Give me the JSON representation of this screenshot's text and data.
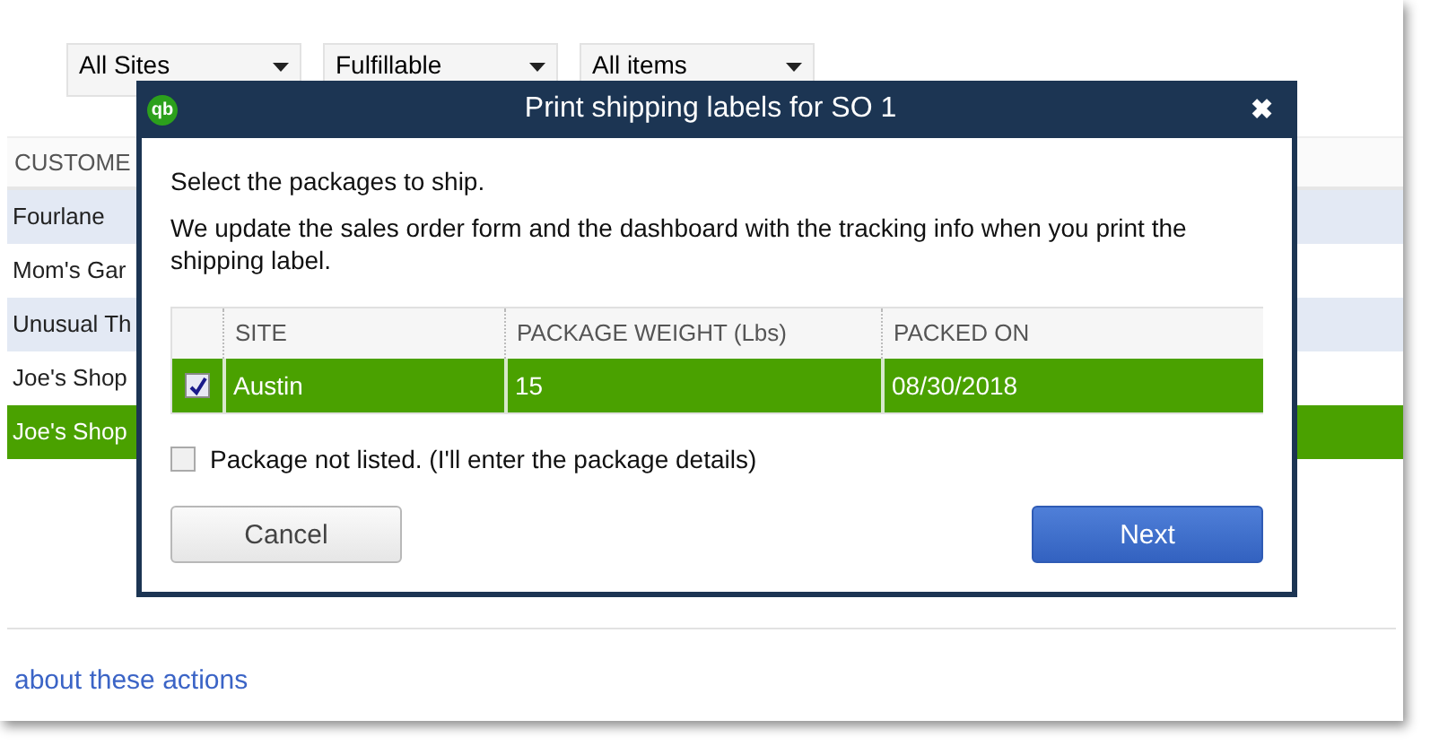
{
  "filters": [
    {
      "value": "All Sites"
    },
    {
      "value": "Fulfillable"
    },
    {
      "value": "All items"
    }
  ],
  "customers": {
    "column": "CUSTOME",
    "rows": [
      {
        "name": "Fourlane",
        "selected": false
      },
      {
        "name": "Mom's Gar",
        "selected": false
      },
      {
        "name": "Unusual Th",
        "selected": false
      },
      {
        "name": "Joe's Shop",
        "selected": false
      },
      {
        "name": "Joe's Shop",
        "selected": true
      }
    ]
  },
  "help_link": "about these actions",
  "dialog": {
    "title": "Print shipping labels for SO 1",
    "close": "✖",
    "logo": "qb",
    "instruction": "Select the packages to ship.",
    "note": "We update the sales order form and the dashboard with the tracking info when you print the shipping label.",
    "columns": [
      "SITE",
      "PACKAGE WEIGHT (Lbs)",
      "PACKED ON"
    ],
    "packages": [
      {
        "site": "Austin",
        "weight": "15",
        "packed_on": "08/30/2018",
        "checked": true,
        "selected": true
      }
    ],
    "not_listed": {
      "label": "Package not listed. (I'll enter the package details)",
      "checked": false
    },
    "buttons": [
      {
        "label": "Cancel",
        "kind": "secondary"
      },
      {
        "label": "Next",
        "kind": "primary"
      }
    ]
  }
}
